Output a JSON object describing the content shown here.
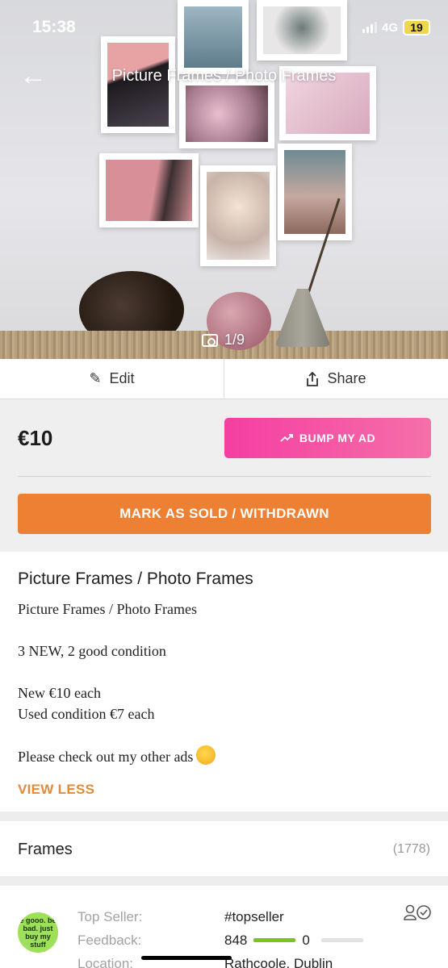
{
  "status_bar": {
    "time": "15:38",
    "network": "4G",
    "battery": "19"
  },
  "header": {
    "title": "Picture Frames / Photo Frames",
    "back_icon": "arrow-left-icon"
  },
  "gallery": {
    "counter": "1/9",
    "icon": "camera-icon"
  },
  "actions": {
    "edit_label": "Edit",
    "share_label": "Share"
  },
  "listing": {
    "price": "€10",
    "bump_label": "BUMP MY AD",
    "sold_label": "MARK AS SOLD / WITHDRAWN",
    "title": "Picture Frames / Photo Frames",
    "description": "Picture Frames / Photo Frames\n\n3 NEW, 2 good condition\n\nNew €10 each\nUsed condition  €7 each\n\nPlease check out my other ads",
    "view_less_label": "VIEW LESS"
  },
  "category": {
    "name": "Frames",
    "count": "(1778)"
  },
  "seller": {
    "avatar_text": "e gooo. be bad. just buy my stuff",
    "labels": {
      "top_seller": "Top Seller:",
      "feedback": "Feedback:",
      "location": "Location:"
    },
    "top_seller_value": "#topseller",
    "feedback_positive": "848",
    "feedback_negative": "0",
    "location_value": "Rathcoole, Dublin"
  },
  "colors": {
    "bump": "#f53ea2",
    "sold": "#ee8033",
    "view_less": "#e38a3c",
    "feedback_bar": "#7cc321"
  }
}
